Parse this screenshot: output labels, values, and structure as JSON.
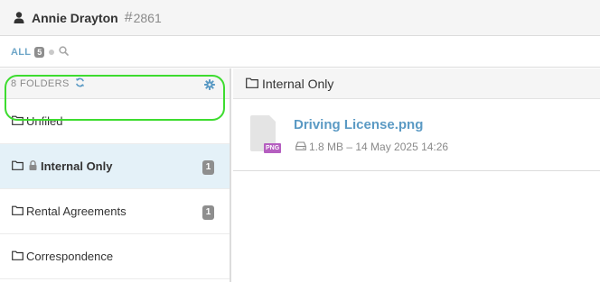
{
  "contact": {
    "name": "Annie Drayton",
    "id": "2861"
  },
  "filter": {
    "all_label": "ALL",
    "all_count": "5"
  },
  "sidebar": {
    "folders_count_label": "8 FOLDERS",
    "items": [
      {
        "label": "Unfiled",
        "badge": null,
        "locked": false,
        "selected": false
      },
      {
        "label": "Internal Only",
        "badge": "1",
        "locked": true,
        "selected": true
      },
      {
        "label": "Rental Agreements",
        "badge": "1",
        "locked": false,
        "selected": false
      },
      {
        "label": "Correspondence",
        "badge": null,
        "locked": false,
        "selected": false
      }
    ]
  },
  "panel": {
    "title": "Internal Only",
    "files": [
      {
        "name": "Driving License.png",
        "type_tag": "PNG",
        "meta": "1.8 MB – 14 May 2025 14:26"
      }
    ]
  },
  "colors": {
    "accent": "#5b9ac4",
    "selected_bg": "#e4f1f8",
    "highlight": "#3ddc2f",
    "badge": "#8e8e8e",
    "png_tag": "#b55fc0"
  },
  "icons": [
    "person-icon",
    "hash-icon",
    "search-icon",
    "refresh-icon",
    "settings-icon",
    "folder-icon",
    "lock-icon",
    "drive-icon"
  ]
}
